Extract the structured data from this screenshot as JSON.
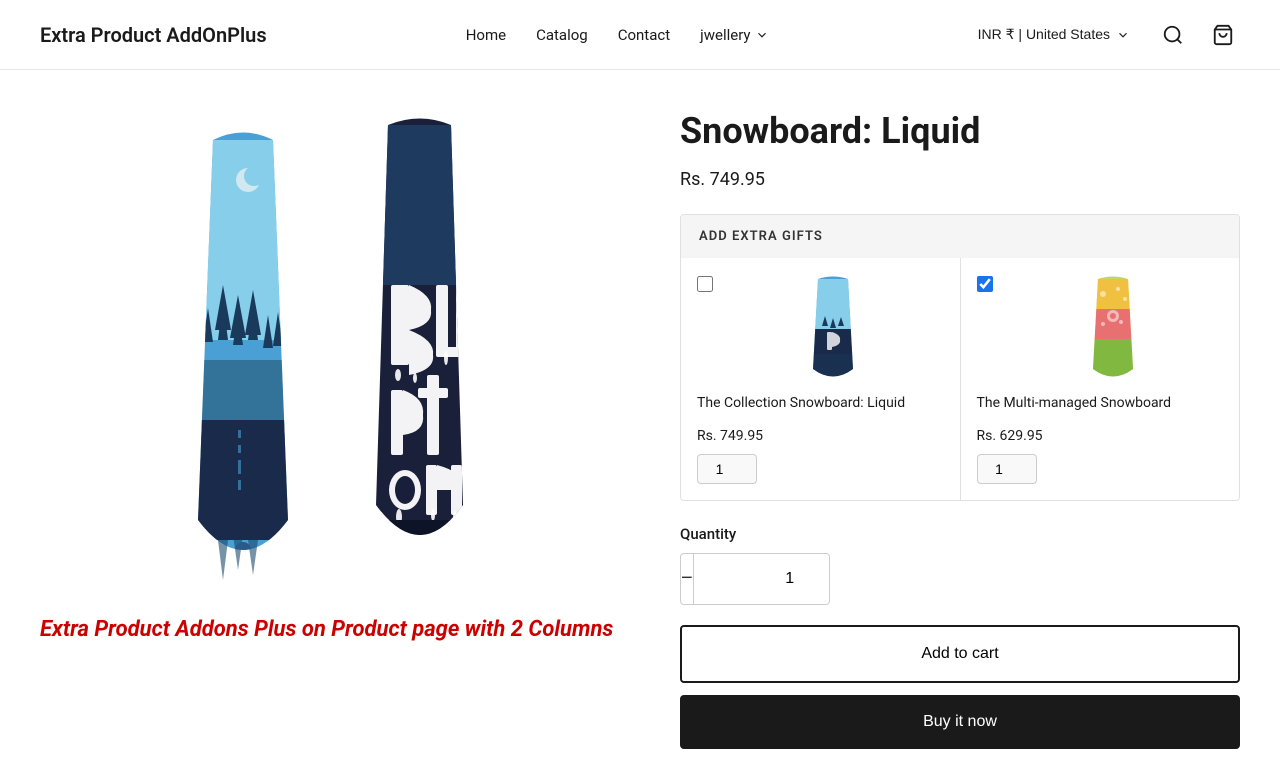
{
  "header": {
    "logo": "Extra Product AddOnPlus",
    "nav": [
      {
        "label": "Home",
        "href": "#"
      },
      {
        "label": "Catalog",
        "href": "#"
      },
      {
        "label": "Contact",
        "href": "#"
      },
      {
        "label": "jwellery",
        "dropdown": true,
        "href": "#"
      }
    ],
    "currency": "INR ₹ | United States",
    "currency_short": "INR ₹",
    "country": "United States"
  },
  "product": {
    "title": "Snowboard: Liquid",
    "price": "Rs. 749.95"
  },
  "extra_gifts": {
    "section_title": "ADD EXTRA GIFTS",
    "items": [
      {
        "id": "gift1",
        "name": "The Collection Snowboard: Liquid",
        "price": "Rs. 749.95",
        "qty": "1",
        "checked": false,
        "color1": "#4a9fd4",
        "color2": "#1a3a5c"
      },
      {
        "id": "gift2",
        "name": "The Multi-managed Snowboard",
        "price": "Rs. 629.95",
        "qty": "1",
        "checked": true,
        "color1": "#f0c040",
        "color2": "#e87070"
      }
    ]
  },
  "quantity": {
    "label": "Quantity",
    "value": "1",
    "decrement_label": "−",
    "increment_label": "+"
  },
  "buttons": {
    "add_to_cart": "Add to cart",
    "buy_now": "Buy it now"
  },
  "promo": {
    "text": "Extra Product Addons Plus on Product page with 2 Columns"
  }
}
